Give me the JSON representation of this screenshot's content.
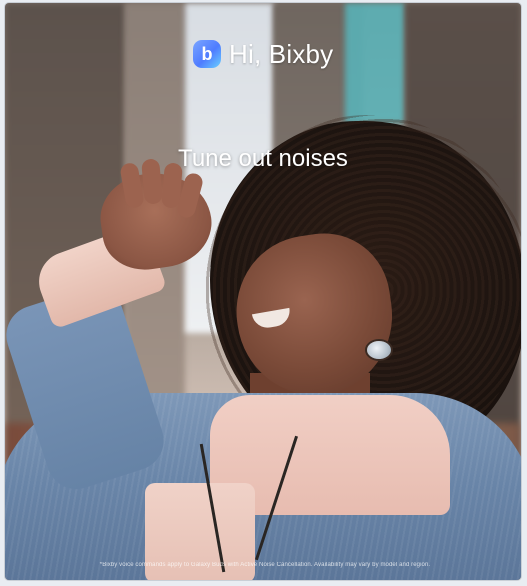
{
  "brand": {
    "icon": "bixby-icon",
    "icon_glyph": "b",
    "title": "Hi, Bixby",
    "accent": "#4f7cff"
  },
  "headline": "Tune out noises",
  "disclaimer": "*Bixby voice commands apply to Galaxy Buds with Active Noise Cancellation. Availability may vary by model and region."
}
